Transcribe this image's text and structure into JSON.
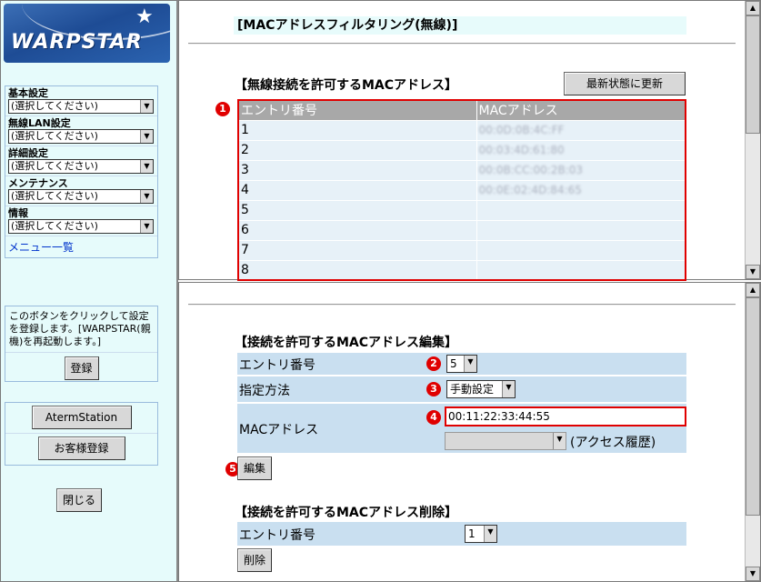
{
  "sidebar": {
    "logo_text": "WARPSTAR",
    "menus": [
      {
        "label": "基本設定",
        "value": "(選択してください)"
      },
      {
        "label": "無線LAN設定",
        "value": "(選択してください)"
      },
      {
        "label": "詳細設定",
        "value": "(選択してください)"
      },
      {
        "label": "メンテナンス",
        "value": "(選択してください)"
      },
      {
        "label": "情報",
        "value": "(選択してください)"
      }
    ],
    "menu_list_link": "メニュー一覧",
    "register_note": "このボタンをクリックして設定を登録します。[WARPSTAR(親機)を再起動します。]",
    "register_button": "登録",
    "aterm_button": "AtermStation",
    "customer_button": "お客様登録",
    "close_button": "閉じる"
  },
  "top": {
    "page_title": "[MACアドレスフィルタリング(無線)]",
    "section_title": "【無線接続を許可するMACアドレス】",
    "refresh_button": "最新状態に更新",
    "table_headers": [
      "エントリ番号",
      "MACアドレス"
    ],
    "rows": [
      {
        "entry": "1",
        "mac": "00:0D:0B:4C:FF"
      },
      {
        "entry": "2",
        "mac": "00:03:4D:61:80"
      },
      {
        "entry": "3",
        "mac": "00:0B:CC:00:2B:03"
      },
      {
        "entry": "4",
        "mac": "00:0E:02:4D:84:65"
      },
      {
        "entry": "5",
        "mac": ""
      },
      {
        "entry": "6",
        "mac": ""
      },
      {
        "entry": "7",
        "mac": ""
      },
      {
        "entry": "8",
        "mac": ""
      }
    ]
  },
  "edit": {
    "section_title": "【接続を許可するMACアドレス編集】",
    "entry_label": "エントリ番号",
    "entry_value": "5",
    "method_label": "指定方法",
    "method_value": "手動設定",
    "mac_label": "MACアドレス",
    "mac_value": "00:11:22:33:44:55",
    "history_label": "(アクセス履歴)",
    "history_value": "",
    "edit_button": "編集"
  },
  "delete": {
    "section_title": "【接続を許可するMACアドレス削除】",
    "entry_label": "エントリ番号",
    "entry_value": "1",
    "delete_button": "削除"
  },
  "badges": [
    "1",
    "2",
    "3",
    "4",
    "5"
  ],
  "colors": {
    "highlight": "#e00000",
    "panel_bg": "#e6fbfb",
    "row_bg": "#c9dff0"
  }
}
